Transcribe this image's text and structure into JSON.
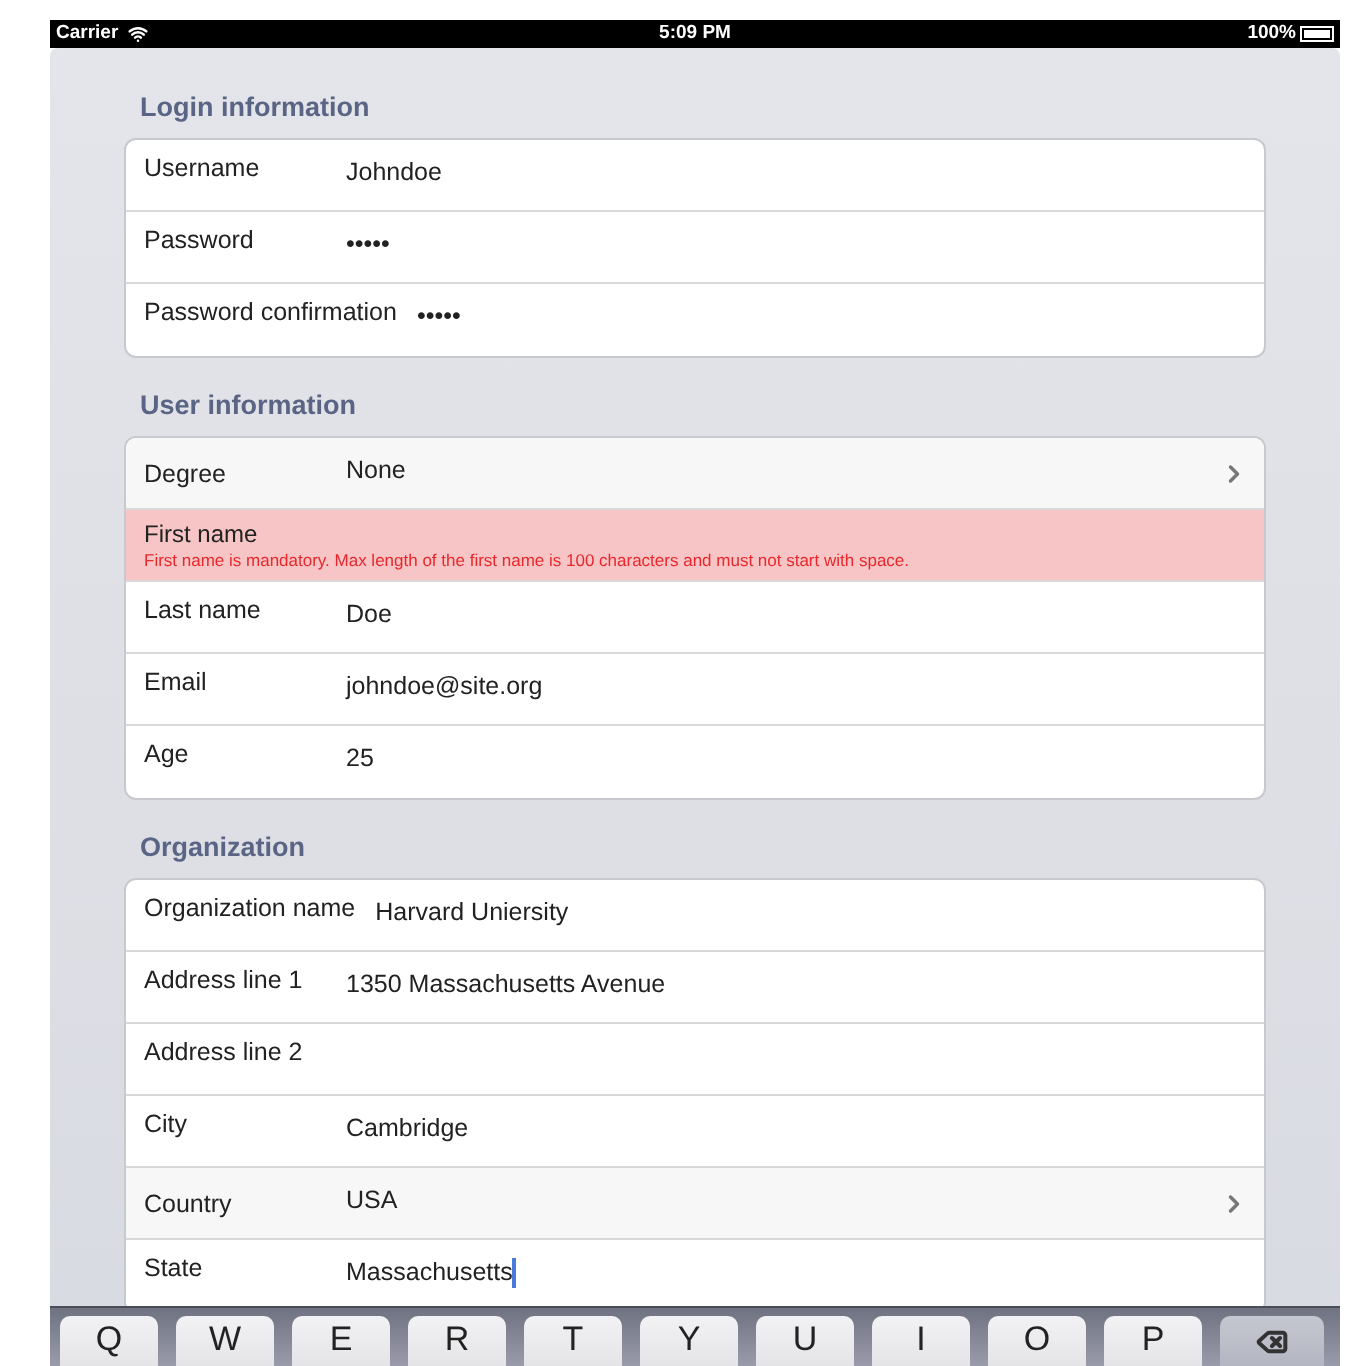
{
  "status_bar": {
    "carrier": "Carrier",
    "time": "5:09 PM",
    "battery": "100%"
  },
  "sections": [
    {
      "title": "Login information",
      "rows": [
        {
          "kind": "text",
          "label": "Username",
          "value": "Johndoe"
        },
        {
          "kind": "text",
          "label": "Password",
          "value": "•••••"
        },
        {
          "kind": "text",
          "label": "Password confirmation",
          "value": "•••••"
        }
      ]
    },
    {
      "title": "User information",
      "rows": [
        {
          "kind": "picker",
          "label": "Degree",
          "value": "None"
        },
        {
          "kind": "error",
          "label": "First name",
          "error": "First name is mandatory. Max length of the first name is 100 characters and must not start with space."
        },
        {
          "kind": "text",
          "label": "Last name",
          "value": "Doe"
        },
        {
          "kind": "text",
          "label": "Email",
          "value": "johndoe@site.org"
        },
        {
          "kind": "text",
          "label": "Age",
          "value": "25"
        }
      ]
    },
    {
      "title": "Organization",
      "rows": [
        {
          "kind": "text",
          "label": "Organization name",
          "value": "Harvard Uniersity"
        },
        {
          "kind": "text",
          "label": "Address line 1",
          "value": "1350 Massachusetts Avenue"
        },
        {
          "kind": "text",
          "label": "Address line 2"
        },
        {
          "kind": "text",
          "label": "City",
          "value": "Cambridge"
        },
        {
          "kind": "picker",
          "label": "Country",
          "value": "USA"
        },
        {
          "kind": "text",
          "label": "State",
          "value": "Massachusetts",
          "focused": true
        }
      ]
    }
  ],
  "keyboard": {
    "keys": [
      "Q",
      "W",
      "E",
      "R",
      "T",
      "Y",
      "U",
      "I",
      "O",
      "P"
    ]
  }
}
